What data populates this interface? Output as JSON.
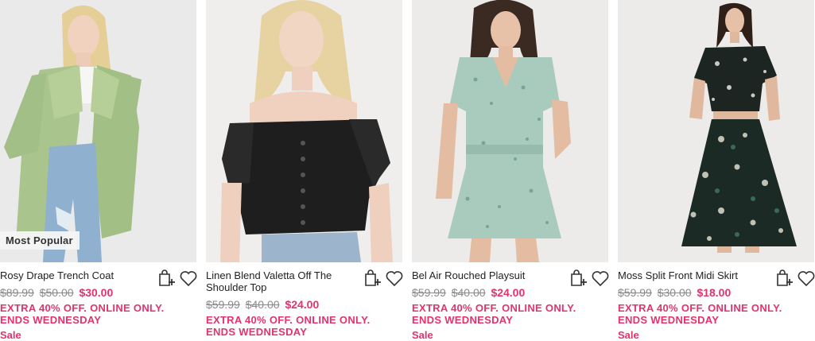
{
  "colors": {
    "accent": "#e2336b",
    "strike": "#8a8a8a"
  },
  "products": [
    {
      "image": "woman-in-sage-green-trench-coat",
      "badge": "Most Popular",
      "name": "Rosy Drape Trench Coat",
      "prices": [
        "$89.99",
        "$50.00"
      ],
      "current": "$30.00",
      "promo": "EXTRA 40% OFF. ONLINE ONLY. ENDS WEDNESDAY",
      "sale": "Sale"
    },
    {
      "image": "woman-in-black-off-shoulder-top",
      "badge": "",
      "name": "Linen Blend Valetta Off The Shoulder Top",
      "prices": [
        "$59.99",
        "$40.00"
      ],
      "current": "$24.00",
      "promo": "EXTRA 40% OFF. ONLINE ONLY. ENDS WEDNESDAY",
      "sale": ""
    },
    {
      "image": "woman-in-mint-floral-playsuit",
      "badge": "",
      "name": "Bel Air Rouched Playsuit",
      "prices": [
        "$59.99",
        "$40.00"
      ],
      "current": "$24.00",
      "promo": "EXTRA 40% OFF. ONLINE ONLY. ENDS WEDNESDAY",
      "sale": "Sale"
    },
    {
      "image": "woman-in-black-floral-midi-skirt",
      "badge": "",
      "name": "Moss Split Front Midi Skirt",
      "prices": [
        "$59.99",
        "$30.00"
      ],
      "current": "$18.00",
      "promo": "EXTRA 40% OFF. ONLINE ONLY. ENDS WEDNESDAY",
      "sale": "Sale"
    }
  ],
  "icons": {
    "bag": "add-to-bag-icon",
    "wishlist": "heart-icon"
  }
}
